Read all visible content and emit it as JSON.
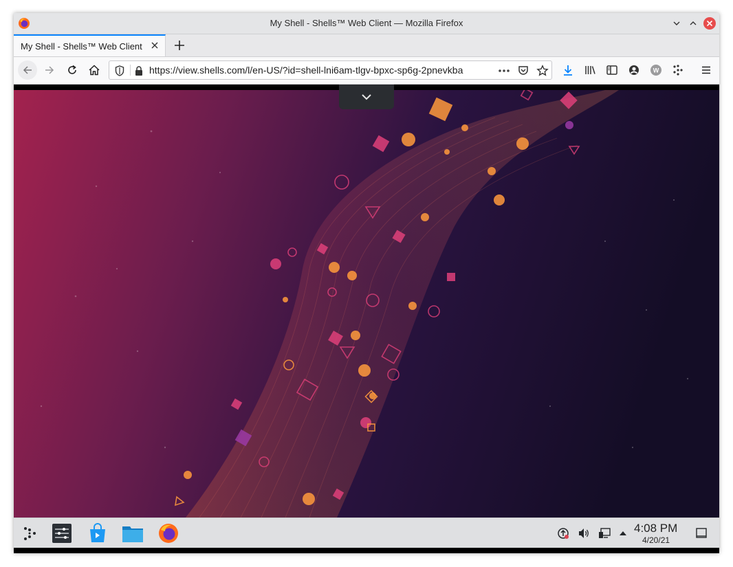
{
  "window": {
    "title": "My Shell - Shells™ Web Client — Mozilla Firefox"
  },
  "tabs": [
    {
      "label": "My Shell - Shells™ Web Client",
      "active": true
    }
  ],
  "navbar": {
    "url": "https://view.shells.com/l/en-US/?id=shell-lni6am-tlgv-bpxc-sp6g-2pnevkba",
    "icons": [
      "back-icon",
      "forward-icon",
      "reload-icon",
      "home-icon",
      "tracking-shield-icon",
      "lock-icon",
      "page-actions-icon",
      "pocket-icon",
      "bookmark-star-icon",
      "download-icon",
      "library-icon",
      "sidebar-icon",
      "account-icon",
      "extension-w-icon",
      "extension-icon",
      "menu-icon"
    ]
  },
  "remote_desktop": {
    "toolbar_toggle_icon": "chevron-down-icon",
    "wallpaper": "kde-plasma-abstract-wallpaper"
  },
  "taskbar": {
    "launchers": [
      "application-launcher-icon",
      "system-settings-icon",
      "discover-store-icon",
      "file-manager-icon",
      "firefox-icon"
    ],
    "tray": [
      "update-notifier-icon",
      "volume-icon",
      "network-icon",
      "tray-expander-icon",
      "show-desktop-icon"
    ],
    "clock_time": "4:08 PM",
    "clock_date": "4/20/21"
  },
  "colors": {
    "accent": "#0a84ff",
    "titlebar": "#e4e5e7",
    "taskbar": "#dfe0e2",
    "close_button": "#e74c4c"
  }
}
